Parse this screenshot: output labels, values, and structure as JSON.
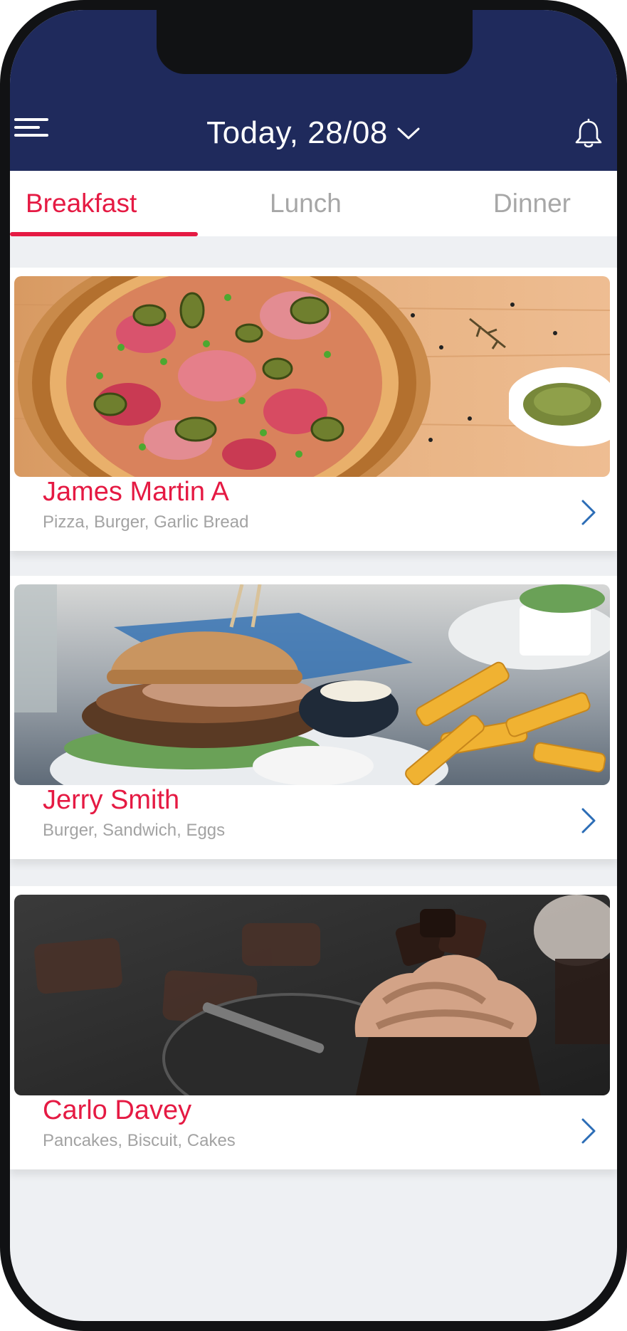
{
  "header": {
    "title": "Today, 28/08",
    "menu_icon": "menu-icon",
    "dropdown_icon": "chevron-down-icon",
    "notification_icon": "bell-icon",
    "background_color": "#1f2a5c"
  },
  "tabs": [
    {
      "label": "Breakfast",
      "active": true
    },
    {
      "label": "Lunch",
      "active": false
    },
    {
      "label": "Dinner",
      "active": false
    }
  ],
  "accent_color": "#e51a43",
  "cards": [
    {
      "name": "James Martin A",
      "items": "Pizza, Burger, Garlic Bread",
      "image": "pizza-photo",
      "chevron_icon": "chevron-right-icon"
    },
    {
      "name": "Jerry Smith",
      "items": "Burger, Sandwich, Eggs",
      "image": "burger-photo",
      "chevron_icon": "chevron-right-icon"
    },
    {
      "name": "Carlo Davey",
      "items": "Pancakes, Biscuit, Cakes",
      "image": "cupcake-photo",
      "chevron_icon": "chevron-right-icon"
    }
  ]
}
